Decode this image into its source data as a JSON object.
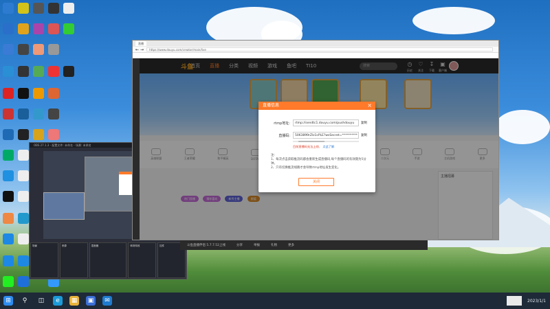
{
  "taskbar": {
    "icons": [
      "start-icon",
      "search-icon",
      "task-view-icon",
      "edge-icon",
      "explorer-icon",
      "store-icon",
      "mail-icon"
    ],
    "systray": "2023/1/1"
  },
  "browser": {
    "tab_title": "直播",
    "address": "https://www.douyu.com/creator/main/live"
  },
  "site": {
    "logo": "斗鱼",
    "nav": [
      "首页",
      "直播",
      "分类",
      "视频",
      "游戏",
      "鱼吧",
      "TI10"
    ],
    "search_placeholder": "搜索",
    "nav_icons": [
      {
        "label": "历史"
      },
      {
        "label": "关注"
      },
      {
        "label": "下载"
      },
      {
        "label": "客户端"
      }
    ],
    "categories": [
      "英雄联盟",
      "王者荣耀",
      "和平精英",
      "DOTA2",
      "绝地求生",
      "颜值",
      "户外",
      "二次元",
      "手游",
      "主机游戏",
      "更多"
    ],
    "pills": [
      "热门直播",
      "猜你喜欢",
      "新秀主播",
      "颜值"
    ],
    "side_title": "主播招募"
  },
  "dialog": {
    "title": "直播信息",
    "close": "×",
    "rtmp_label": "rtmp地址:",
    "rtmp_value": "rtmp://sendtc1.douyu.com/pushdouyu",
    "rtmp_copy": "复制",
    "code_label": "直播码:",
    "code_value": "5063899rZlz1cPLE?wsSecret=**********",
    "code_copy": "复制",
    "hint_red": "目前直播码无法上线,",
    "hint_link": "点此了解",
    "notes_title": "注:",
    "notes": [
      "1、每次点击获取推流码都会重新生成直播码,每个直播码的有效期为5分钟。",
      "2、只有切换推流线路才会导致rtmp地址发生变化。"
    ],
    "close_button": "关闭"
  },
  "obs": {
    "title": "OBS 27.1.3 - 配置文件: 未命名 - 场景: 未命名",
    "docks": [
      {
        "title": "场景"
      },
      {
        "title": "来源"
      },
      {
        "title": "混音器"
      },
      {
        "title": "转场特效"
      },
      {
        "title": "控件"
      }
    ]
  },
  "bottombar": {
    "items": [
      "斗鱼直播伴侣 5.7.7.52上线",
      "分享",
      "举报",
      "礼物",
      "更多"
    ]
  }
}
